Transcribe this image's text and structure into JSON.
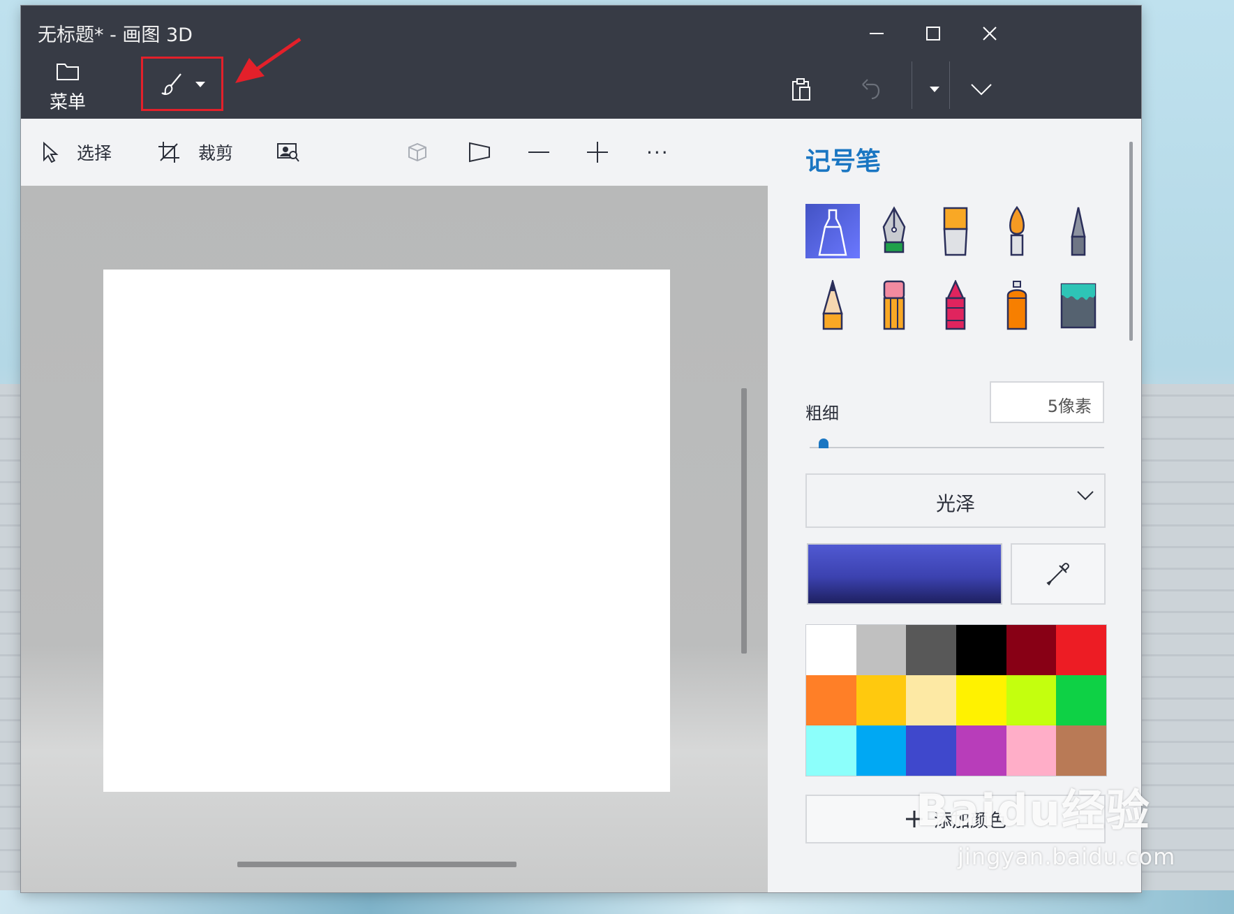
{
  "window": {
    "title": "无标题* - 画图 3D",
    "controls": [
      "minimize",
      "maximize",
      "close"
    ]
  },
  "commandbar": {
    "menu_label": "菜单",
    "menu_icon": "folder-icon",
    "brush_icon": "brush-icon",
    "paste_icon": "paste-icon",
    "undo_icon": "undo-icon",
    "history_icon": "chevron-down-icon",
    "expand_icon": "chevron-down-icon"
  },
  "toolbar": {
    "select_label": "选择",
    "crop_label": "裁剪",
    "magic_select_icon": "magic-select-icon",
    "view3d_icon": "3d-view-icon",
    "perspective_icon": "perspective-icon",
    "zoom_out_icon": "minus-icon",
    "zoom_in_icon": "plus-icon",
    "more_label": "···"
  },
  "panel": {
    "title": "记号笔",
    "tools": [
      {
        "name": "marker",
        "selected": true
      },
      {
        "name": "calligraphy-pen",
        "selected": false
      },
      {
        "name": "oil-brush",
        "selected": false
      },
      {
        "name": "watercolor",
        "selected": false
      },
      {
        "name": "pixel-pen",
        "selected": false
      },
      {
        "name": "pencil",
        "selected": false
      },
      {
        "name": "eraser",
        "selected": false
      },
      {
        "name": "crayon",
        "selected": false
      },
      {
        "name": "spray-can",
        "selected": false
      },
      {
        "name": "fill-bucket",
        "selected": false
      }
    ],
    "thickness_label": "粗细",
    "thickness_value": "5像素",
    "thickness_fraction": 0.03,
    "finish_label": "光泽",
    "current_color": "#3c42b0",
    "palette": [
      "#ffffff",
      "#c0c0c0",
      "#585858",
      "#000000",
      "#880015",
      "#ed1c24",
      "#ff7f27",
      "#ffc90e",
      "#fde9a4",
      "#fff200",
      "#c4ff0e",
      "#0ed145",
      "#8cfffb",
      "#00a8f3",
      "#3f48cc",
      "#b83dba",
      "#ffaec8",
      "#b97a56"
    ],
    "add_color_label": "添加颜色"
  },
  "watermark": {
    "main": "Baidu经验",
    "sub": "jingyan.baidu.com"
  },
  "colors": {
    "titlebar": "#373b45",
    "accent": "#1a76c2",
    "highlight": "#e3202a"
  }
}
